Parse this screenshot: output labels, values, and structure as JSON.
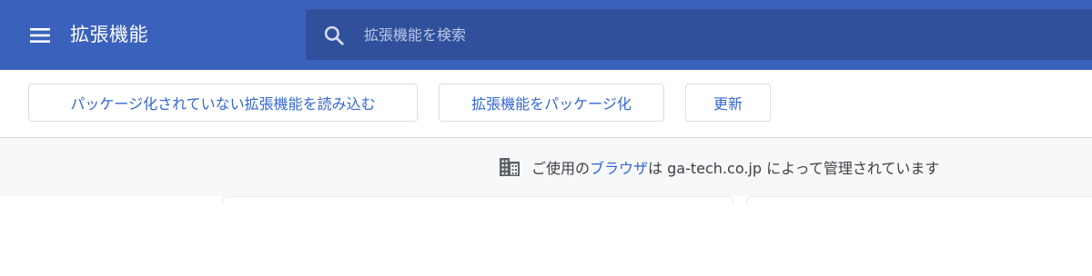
{
  "header": {
    "title": "拡張機能",
    "menu_icon": "hamburger-menu-icon",
    "background_color": "#3a62bd"
  },
  "search": {
    "placeholder": "拡張機能を検索",
    "value": "",
    "icon": "search-icon"
  },
  "toolbar": {
    "load_unpacked_label": "パッケージ化されていない拡張機能を読み込む",
    "pack_extension_label": "拡張機能をパッケージ化",
    "update_label": "更新",
    "button_text_color": "#3367d6"
  },
  "managed_notice": {
    "icon": "building-icon",
    "prefix": "ご使用の",
    "link_text": "ブラウザ",
    "middle": "は",
    "domain": "ga-tech.co.jp",
    "suffix": "によって管理されています"
  }
}
